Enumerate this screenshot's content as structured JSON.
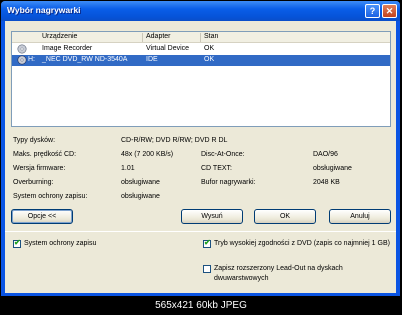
{
  "window": {
    "title": "Wybór nagrywarki",
    "help_glyph": "?",
    "close_glyph": "✕"
  },
  "list": {
    "columns": [
      "Urządzenie",
      "Adapter",
      "Stan"
    ],
    "rows": [
      {
        "device": "Image Recorder",
        "adapter": "Virtual Device",
        "status": "OK",
        "selected": false
      },
      {
        "prefix": "H:",
        "device": "_NEC DVD_RW ND-3540A",
        "adapter": "IDE",
        "status": "OK",
        "selected": true
      }
    ]
  },
  "properties": {
    "disc_types_label": "Typy dysków:",
    "disc_types_value": "CD-R/RW; DVD R/RW; DVD R DL",
    "max_speed_label": "Maks. prędkość CD:",
    "max_speed_value": "48x (7 200 KB/s)",
    "disc_at_once_label": "Disc-At-Once:",
    "disc_at_once_value": "DAO/96",
    "firmware_label": "Wersja firmware:",
    "firmware_value": "1.01",
    "cd_text_label": "CD TEXT:",
    "cd_text_value": "obsługiwane",
    "overburning_label": "Overburning:",
    "overburning_value": "obsługiwane",
    "buffer_label": "Bufor nagrywarki:",
    "buffer_value": "2048 KB",
    "protection_label": "System ochrony zapisu:",
    "protection_value": "obsługiwane"
  },
  "buttons": {
    "options": "Opcje <<",
    "eject": "Wysuń",
    "ok": "OK",
    "cancel": "Anuluj"
  },
  "options": {
    "protection": {
      "label": "System ochrony zapisu",
      "checked": true
    },
    "dvd_compat": {
      "label": "Tryb wysokiej zgodności z DVD (zapis co najmniej 1 GB)",
      "checked": true
    },
    "lead_out": {
      "label": "Zapisz rozszerzony Lead-Out na dyskach dwuwarstwowych",
      "checked": false
    }
  },
  "caption": "565x421 60kb JPEG"
}
